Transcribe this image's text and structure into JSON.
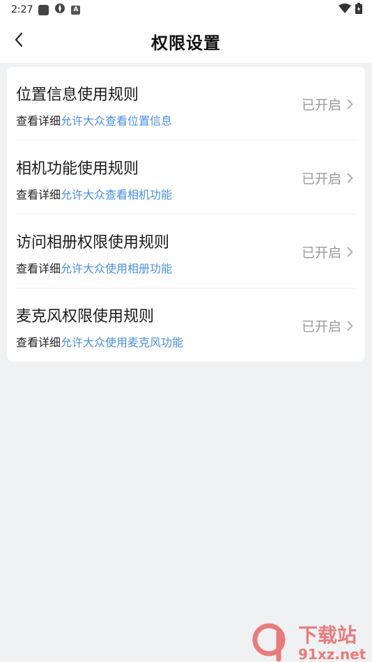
{
  "status_bar": {
    "time": "2:27"
  },
  "header": {
    "title": "权限设置"
  },
  "permissions": [
    {
      "title": "位置信息使用规则",
      "detail_prefix": "查看详细",
      "detail_link": "允许大众查看位置信息",
      "status": "已开启"
    },
    {
      "title": "相机功能使用规则",
      "detail_prefix": "查看详细",
      "detail_link": "允许大众查看相机功能",
      "status": "已开启"
    },
    {
      "title": "访问相册权限使用规则",
      "detail_prefix": "查看详细",
      "detail_link": "允许大众使用相册功能",
      "status": "已开启"
    },
    {
      "title": "麦克风权限使用规则",
      "detail_prefix": "查看详细",
      "detail_link": "允许大众使用麦克风功能",
      "status": "已开启"
    }
  ],
  "watermark": {
    "brand": "下载站",
    "site": "91xz.net"
  },
  "colors": {
    "link": "#4a90e2",
    "background": "#f0f1f3",
    "status_text": "#9a9a9a",
    "watermark": "#e85a5a"
  }
}
